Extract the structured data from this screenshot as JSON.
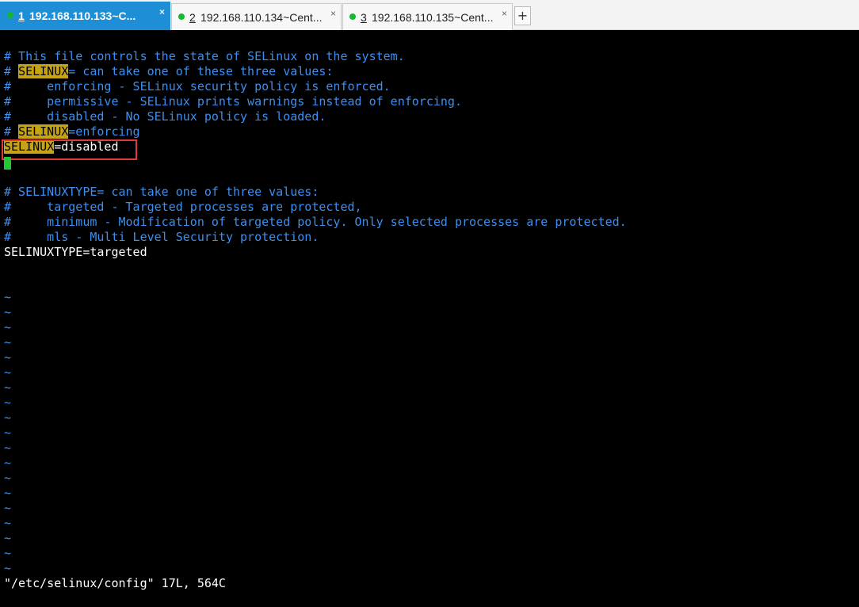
{
  "tabs": [
    {
      "number": "1",
      "title": "192.168.110.133~C...",
      "close": "×",
      "active": true
    },
    {
      "number": "2",
      "title": "192.168.110.134~Cent...",
      "close": "×",
      "active": false
    },
    {
      "number": "3",
      "title": "192.168.110.135~Cent...",
      "close": "×",
      "active": false
    }
  ],
  "new_tab_label": "+",
  "status_color": "#12b82e",
  "accent_color": "#1e8fd6",
  "editor": {
    "lines": {
      "l1": "# This file controls the state of SELinux on the system.",
      "l2_hash": "# ",
      "l2_key": "SELINUX",
      "l2_rest": "= can take one of these three values:",
      "l3": "#     enforcing - SELinux security policy is enforced.",
      "l4": "#     permissive - SELinux prints warnings instead of enforcing.",
      "l5": "#     disabled - No SELinux policy is loaded.",
      "l6_hash": "# ",
      "l6_key": "SELINUX",
      "l6_rest": "=enforcing",
      "l7_key": "SELINUX",
      "l7_rest": "=disabled",
      "l9": "# SELINUXTYPE= can take one of three values:",
      "l10": "#     targeted - Targeted processes are protected,",
      "l11": "#     minimum - Modification of targeted policy. Only selected processes are protected.",
      "l12": "#     mls - Multi Level Security protection.",
      "l13": "SELINUXTYPE=targeted"
    },
    "tilde": "~",
    "status_line": "\"/etc/selinux/config\" 17L, 564C"
  }
}
